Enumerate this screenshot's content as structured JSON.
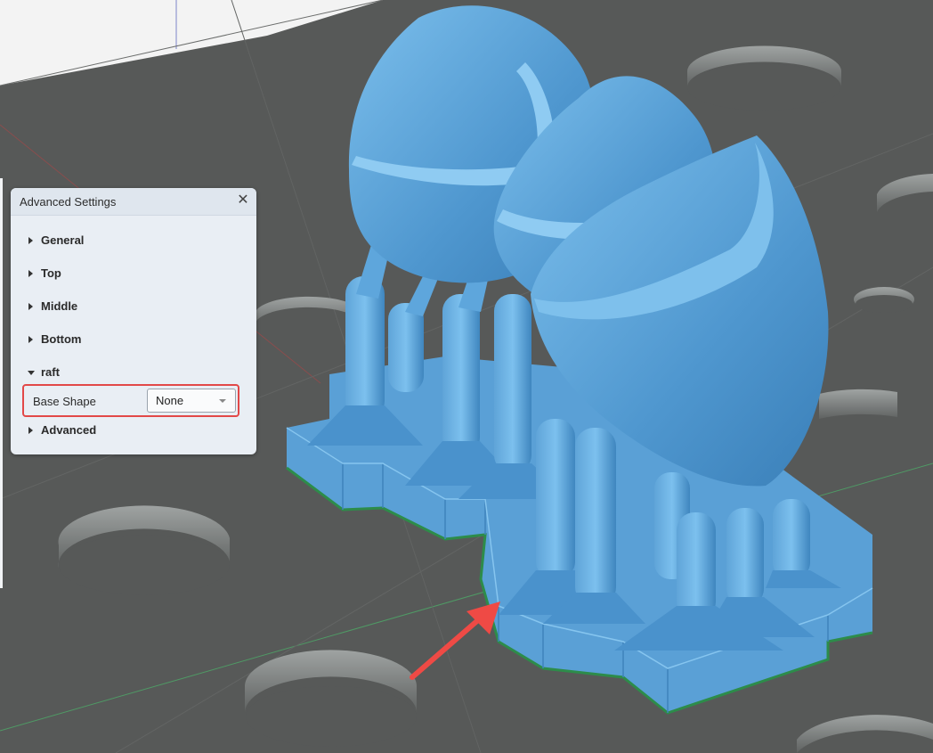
{
  "panel": {
    "title": "Advanced Settings",
    "close_icon": "close-icon",
    "sections": [
      {
        "label": "General",
        "expanded": false
      },
      {
        "label": "Top",
        "expanded": false
      },
      {
        "label": "Middle",
        "expanded": false
      },
      {
        "label": "Bottom",
        "expanded": false
      },
      {
        "label": "raft",
        "expanded": true
      },
      {
        "label": "Advanced",
        "expanded": false
      }
    ],
    "raft": {
      "base_shape_label": "Base Shape",
      "base_shape_value": "None"
    }
  },
  "colors": {
    "model": "#5aa6dc",
    "bed": "#575958",
    "highlight": "#e24848",
    "arrow": "#ef4a45"
  }
}
